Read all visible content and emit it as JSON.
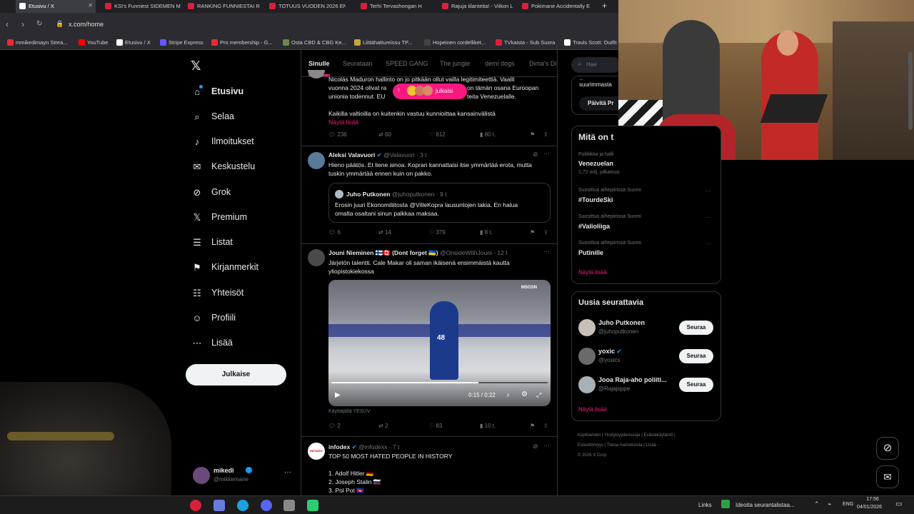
{
  "browser": {
    "tabs": [
      {
        "label": "Etusivu / X"
      },
      {
        "label": "KSI's Funniest SIDEMEN M"
      },
      {
        "label": "RANKING FUNNIESTAI R"
      },
      {
        "label": "TOTUUS VUODEN 2026 EN"
      },
      {
        "label": "Terhi Tervashongan H"
      },
      {
        "label": "Rajuja tilanteita! - Viikon L"
      },
      {
        "label": "Pokimane Accidentally E"
      }
    ],
    "new_tab": "+",
    "url": "x.com/home",
    "bookmarks": [
      {
        "label": "mmikedimayn Strea...",
        "color": "#e0312e"
      },
      {
        "label": "YouTube",
        "color": "#ff0000"
      },
      {
        "label": "Etusivu / X",
        "color": "#ffffff"
      },
      {
        "label": "Stripe Express",
        "color": "#635bff"
      },
      {
        "label": "Pro membership - G...",
        "color": "#e0312e"
      },
      {
        "label": "Osta CBD & CBG Ke...",
        "color": "#6a8a4a"
      },
      {
        "label": "Liittähattureissu TP...",
        "color": "#c9a33a"
      },
      {
        "label": "Hopeinen cordelliket...",
        "color": "#444444"
      },
      {
        "label": "TVkaista - Sub Suora",
        "color": "#d9203a"
      },
      {
        "label": "Travis Scott: Outfit",
        "color": "#ffffff"
      }
    ]
  },
  "sidebar": {
    "items": [
      {
        "label": "Etusivu",
        "icon": "home-icon",
        "glyph": "⌂"
      },
      {
        "label": "Selaa",
        "icon": "search-icon",
        "glyph": "⌕"
      },
      {
        "label": "Ilmoitukset",
        "icon": "bell-icon",
        "glyph": "♪"
      },
      {
        "label": "Keskustelu",
        "icon": "mail-icon",
        "glyph": "✉"
      },
      {
        "label": "Grok",
        "icon": "grok-icon",
        "glyph": "⊘"
      },
      {
        "label": "Premium",
        "icon": "x-logo-icon",
        "glyph": "𝕏"
      },
      {
        "label": "Listat",
        "icon": "list-icon",
        "glyph": "☰"
      },
      {
        "label": "Kirjanmerkit",
        "icon": "bookmark-icon",
        "glyph": "⚑"
      },
      {
        "label": "Yhteisöt",
        "icon": "communities-icon",
        "glyph": "☷"
      },
      {
        "label": "Profiili",
        "icon": "profile-icon",
        "glyph": "☺"
      },
      {
        "label": "Lisää",
        "icon": "more-icon",
        "glyph": "⋯"
      }
    ],
    "post_button": "Julkaise",
    "account_name": "mikedi",
    "account_handle": "@mikkemane"
  },
  "feed": {
    "tabs": [
      "Sinulle",
      "Seurataan",
      "SPEED GANG",
      "The jungle",
      "demi dogs",
      "Dima's Di"
    ],
    "new_posts_pill": "julkaisi",
    "tweet1": {
      "line1": "Nicolás Maduron hallinto on jo pitkään ollut vailla legitimiteettiä. Vaalit",
      "line2": "vuonna 2024 olivat ra",
      "line2b": "on tämän osana Euroopan",
      "line3": "unionia todennut. EU",
      "line3b": "teita Venezuelalle.",
      "line4": "Kaikilla valtioilla on kuitenkin vastuu kunnioittaa kansainvälistä",
      "more": "Näytä lisää",
      "replies": "236",
      "reposts": "60",
      "likes": "812",
      "views": "80 t."
    },
    "tweet2": {
      "name": "Aleksi Valavuori",
      "handle": "@Valavuori · 3 t",
      "line1": "Hieno päätös. Et liene ainoa. Kopran kannattaisi itse ymmärtää erota, mutta",
      "line2": "tuskin ymmärtää ennen kuin on pakko.",
      "quote_name": "Juho Putkonen",
      "quote_handle": "@juhoputkonen · 9 t",
      "quote_line1": "Erosin juuri Ekonomiliitosta @VilleKopra lausuntojen takia. En halua",
      "quote_line2": "omalta osaltani sinun palkkaa maksaa.",
      "replies": "6",
      "reposts": "14",
      "likes": "379",
      "views": "8 t."
    },
    "tweet3": {
      "name": "Jouni Nieminen 🇫🇮🇨🇦 (Dont forget 🇺🇦)",
      "handle": "@OnsideWithJouni · 12 t",
      "line1": "Järjetön talentti. Cale Makar oli saman ikäisenä ensimmäistä kautta",
      "line2": "yliopistokiekossa",
      "video_time": "0:15 / 0:22",
      "video_watermark": "MSGSN",
      "video_by": "Käyttäjältä YESUV",
      "replies": "2",
      "reposts": "2",
      "likes": "83",
      "views": "10 t."
    },
    "tweet4": {
      "name": "infodex",
      "handle": "@infodexx · 7 t",
      "line1": "TOP 50 MOST HATED PEOPLE IN HISTORY",
      "item1": "1. Adolf Hitler 🇩🇪",
      "item2": "2. Joseph Stalin 🇷🇺",
      "item3": "3. Pol Pot 🇰🇭"
    }
  },
  "right": {
    "search_placeholder": "Hae",
    "banner_line1": "...",
    "banner_line2": "suurimmasta",
    "banner_button": "Päivitä Pr",
    "trends_title": "Mitä on t",
    "trends": [
      {
        "meta": "Politiikka ja halli",
        "title": "Venezuelan",
        "count": "1,72 milj. julkaisua"
      },
      {
        "meta": "Suosittua aihepiirissä Suomi",
        "title": "#TourdeSki",
        "count": ""
      },
      {
        "meta": "Suosittua aihepiirissä Suomi",
        "title": "#Valioliiga",
        "count": ""
      },
      {
        "meta": "Suosittua aihepiirissä Suomi",
        "title": "Putinille",
        "count": ""
      }
    ],
    "trends_more": "Näytä lisää",
    "follow_title": "Uusia seurattavia",
    "follow": [
      {
        "name": "Juho Putkonen",
        "handle": "@juhoputkonen",
        "button": "Seuraa"
      },
      {
        "name": "yoxic",
        "handle": "@yoxics",
        "button": "Seuraa"
      },
      {
        "name": "Jooa Raja-aho poliiti...",
        "handle": "@Rajajoppe",
        "button": "Seuraa"
      }
    ],
    "follow_more": "Näytä lisää",
    "footer": [
      "Käyttöehdot",
      "Yksityisyydensuoja",
      "Evästekäytäntö",
      "Esteettömyys",
      "Tietoa mainoksista",
      "Lisää ···",
      "© 2026 X Corp."
    ]
  },
  "taskbar": {
    "links": "Links",
    "notification": "Ideoita seurantalistaa...",
    "lang": "ENG",
    "time": "17:56",
    "date": "04/01/2026"
  },
  "colors": {
    "accent_pink": "#f91880",
    "verified_blue": "#1d9bf0",
    "border": "#2f3336",
    "muted": "#71767b"
  }
}
